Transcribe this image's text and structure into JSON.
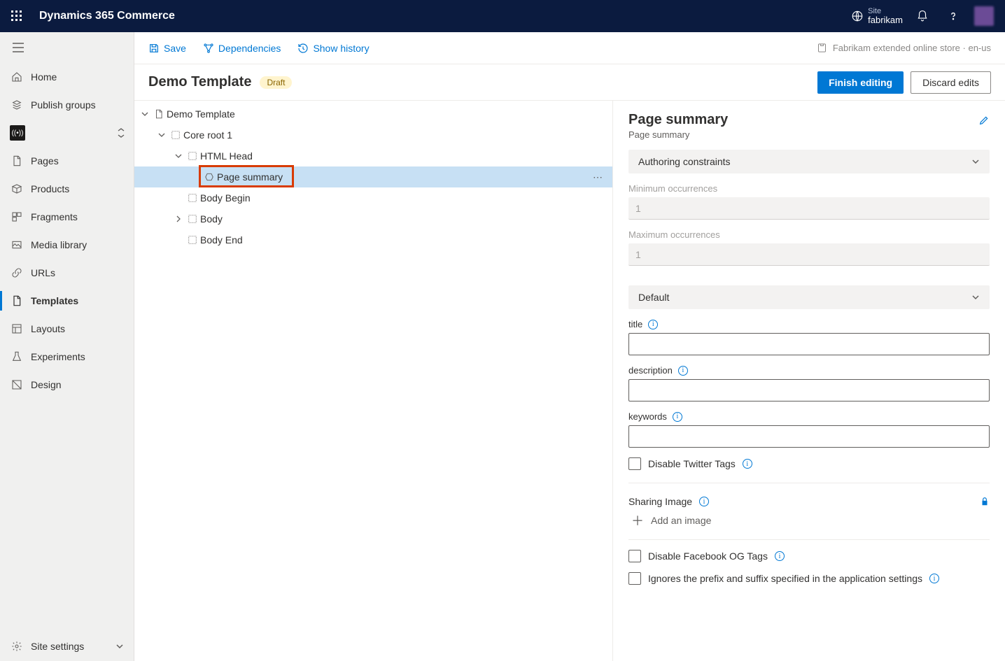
{
  "header": {
    "brand": "Dynamics 365 Commerce",
    "site_label": "Site",
    "site_name": "fabrikam"
  },
  "sidebar": {
    "items": [
      {
        "label": "Home"
      },
      {
        "label": "Publish groups"
      },
      {
        "label": ""
      },
      {
        "label": "Pages"
      },
      {
        "label": "Products"
      },
      {
        "label": "Fragments"
      },
      {
        "label": "Media library"
      },
      {
        "label": "URLs"
      },
      {
        "label": "Templates"
      },
      {
        "label": "Layouts"
      },
      {
        "label": "Experiments"
      },
      {
        "label": "Design"
      }
    ],
    "footer": "Site settings"
  },
  "toolbar": {
    "save": "Save",
    "dependencies": "Dependencies",
    "show_history": "Show history",
    "context": "Fabrikam extended online store · en-us"
  },
  "title": {
    "name": "Demo Template",
    "badge": "Draft",
    "finish": "Finish editing",
    "discard": "Discard edits"
  },
  "tree": [
    {
      "label": "Demo Template",
      "depth": 0,
      "chev": "down",
      "icon": "doc"
    },
    {
      "label": "Core root 1",
      "depth": 1,
      "chev": "down",
      "icon": "container"
    },
    {
      "label": "HTML Head",
      "depth": 2,
      "chev": "down",
      "icon": "container"
    },
    {
      "label": "Page summary",
      "depth": 3,
      "chev": "",
      "icon": "hex",
      "selected": true
    },
    {
      "label": "Body Begin",
      "depth": 2,
      "chev": "",
      "icon": "container"
    },
    {
      "label": "Body",
      "depth": 2,
      "chev": "right",
      "icon": "container"
    },
    {
      "label": "Body End",
      "depth": 2,
      "chev": "",
      "icon": "container"
    }
  ],
  "props": {
    "title": "Page summary",
    "subtitle": "Page summary",
    "section_authoring": "Authoring constraints",
    "min_label": "Minimum occurrences",
    "min_value": "1",
    "max_label": "Maximum occurrences",
    "max_value": "1",
    "section_default": "Default",
    "title_label": "title",
    "description_label": "description",
    "keywords_label": "keywords",
    "disable_twitter": "Disable Twitter Tags",
    "sharing_image": "Sharing Image",
    "add_image": "Add an image",
    "disable_facebook": "Disable Facebook OG Tags",
    "ignore_prefix": "Ignores the prefix and suffix specified in the application settings"
  }
}
